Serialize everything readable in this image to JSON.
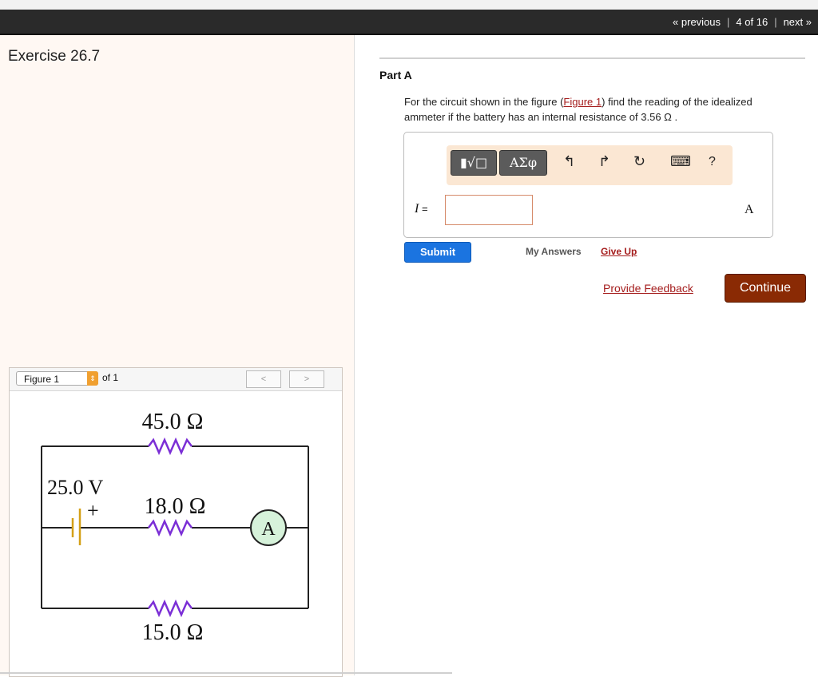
{
  "nav": {
    "previous": "« previous",
    "position": "4 of 16",
    "next": "next »"
  },
  "exercise": {
    "title": "Exercise 26.7"
  },
  "part": {
    "title": "Part A",
    "question_before": "For the circuit shown in the figure (",
    "figure_link": "Figure 1",
    "question_after": ") find the reading of the idealized ammeter if the battery has an internal resistance of 3.56 Ω ."
  },
  "toolbar": {
    "template_btn": "▮√□",
    "greek_btn": "ΑΣφ",
    "undo": "↰",
    "redo": "↱",
    "reset": "↻",
    "keyboard": "⌨",
    "help": "?"
  },
  "answer": {
    "variable": "I",
    "equals": " =",
    "value": "",
    "unit": "A"
  },
  "buttons": {
    "submit": "Submit",
    "my_answers": "My Answers",
    "give_up": "Give Up",
    "feedback": "Provide Feedback",
    "continue": "Continue"
  },
  "figure": {
    "select_label": "Figure 1",
    "of_label": "of 1",
    "prev": "<",
    "next": ">",
    "labels": {
      "r_top": "45.0 Ω",
      "battery": "25.0 V",
      "plus": "+",
      "r_mid": "18.0 Ω",
      "ammeter": "A",
      "r_bottom": "15.0 Ω"
    }
  },
  "colors": {
    "accent": "#1b74e0",
    "link": "#a51e1e",
    "continue": "#8a2a04",
    "resistor": "#7b2fd6",
    "battery": "#d4a017"
  }
}
